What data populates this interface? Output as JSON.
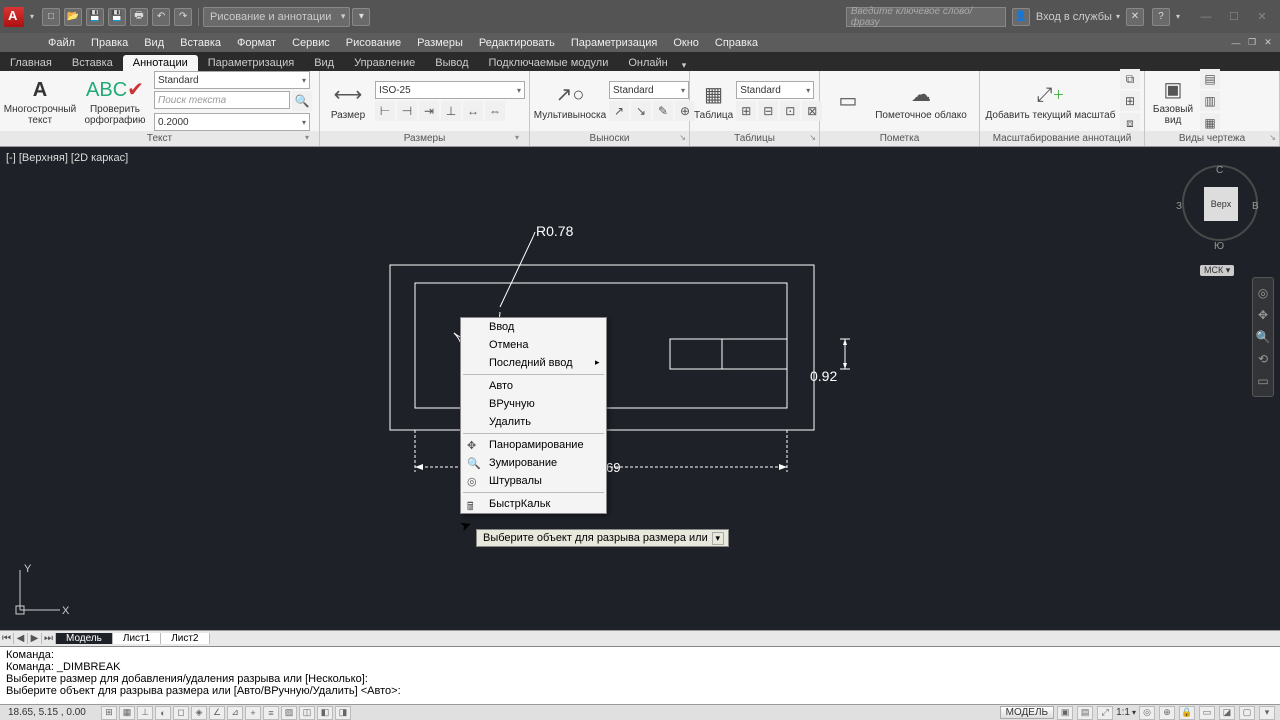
{
  "titlebar": {
    "workspace": "Рисование и аннотации",
    "search_placeholder": "Введите ключевое слово/фразу",
    "signin": "Вход в службы"
  },
  "menu": {
    "items": [
      "Файл",
      "Правка",
      "Вид",
      "Вставка",
      "Формат",
      "Сервис",
      "Рисование",
      "Размеры",
      "Редактировать",
      "Параметризация",
      "Окно",
      "Справка"
    ]
  },
  "ribbon_tabs": {
    "items": [
      "Главная",
      "Вставка",
      "Аннотации",
      "Параметризация",
      "Вид",
      "Управление",
      "Вывод",
      "Подключаемые модули",
      "Онлайн"
    ],
    "active": 2
  },
  "ribbon": {
    "text": {
      "multiline": "Многострочный\nтекст",
      "spellcheck": "Проверить\nорфографию",
      "style": "Standard",
      "find_ph": "Поиск текста",
      "height": "0.2000",
      "title": "Текст"
    },
    "dims": {
      "btn": "Размер",
      "style": "ISO-25",
      "title": "Размеры"
    },
    "leaders": {
      "btn": "Мультивыноска",
      "style": "Standard",
      "title": "Выноски"
    },
    "tables": {
      "btn": "Таблица",
      "style": "Standard",
      "title": "Таблицы"
    },
    "markup": {
      "cloud": "Пометочное облако",
      "title": "Пометка"
    },
    "scaling": {
      "btn": "Добавить текущий масштаб",
      "title": "Масштабирование аннотаций"
    },
    "views": {
      "btn": "Базовый\nвид",
      "title": "Виды чертежа"
    }
  },
  "viewport": {
    "label": "[-] [Верхняя] [2D каркас]"
  },
  "dimensions": {
    "radius": "R0.78",
    "height": "0.92",
    "width_partial": "69"
  },
  "viewcube": {
    "face": "Верх",
    "n": "С",
    "s": "Ю",
    "e": "В",
    "w": "З",
    "wcs": "МСК"
  },
  "ucs": {
    "x": "X",
    "y": "Y"
  },
  "context_menu": {
    "items": [
      {
        "label": "Ввод"
      },
      {
        "label": "Отмена"
      },
      {
        "label": "Последний ввод",
        "submenu": true
      },
      {
        "sep": true
      },
      {
        "label": "Авто"
      },
      {
        "label": "ВРучную"
      },
      {
        "label": "Удалить"
      },
      {
        "sep": true
      },
      {
        "label": "Панорамирование",
        "icon": "✥"
      },
      {
        "label": "Зумирование",
        "icon": "🔍"
      },
      {
        "label": "Штурвалы",
        "icon": "◎"
      },
      {
        "sep": true
      },
      {
        "label": "БыстрКальк",
        "icon": "🖩"
      }
    ]
  },
  "tooltip": "Выберите объект для разрыва размера или",
  "model_tabs": {
    "items": [
      "Модель",
      "Лист1",
      "Лист2"
    ],
    "active": 0
  },
  "command": {
    "lines": [
      "Команда:",
      "Команда: _DIMBREAK",
      "Выберите размер для добавления/удаления разрыва или [Несколько]:",
      "Выберите объект для разрыва размера или [Авто/ВРучную/Удалить] <Авто>:"
    ]
  },
  "status": {
    "coords": "18.65, 5.15 , 0.00",
    "model": "МОДЕЛЬ",
    "scale": "1:1"
  }
}
